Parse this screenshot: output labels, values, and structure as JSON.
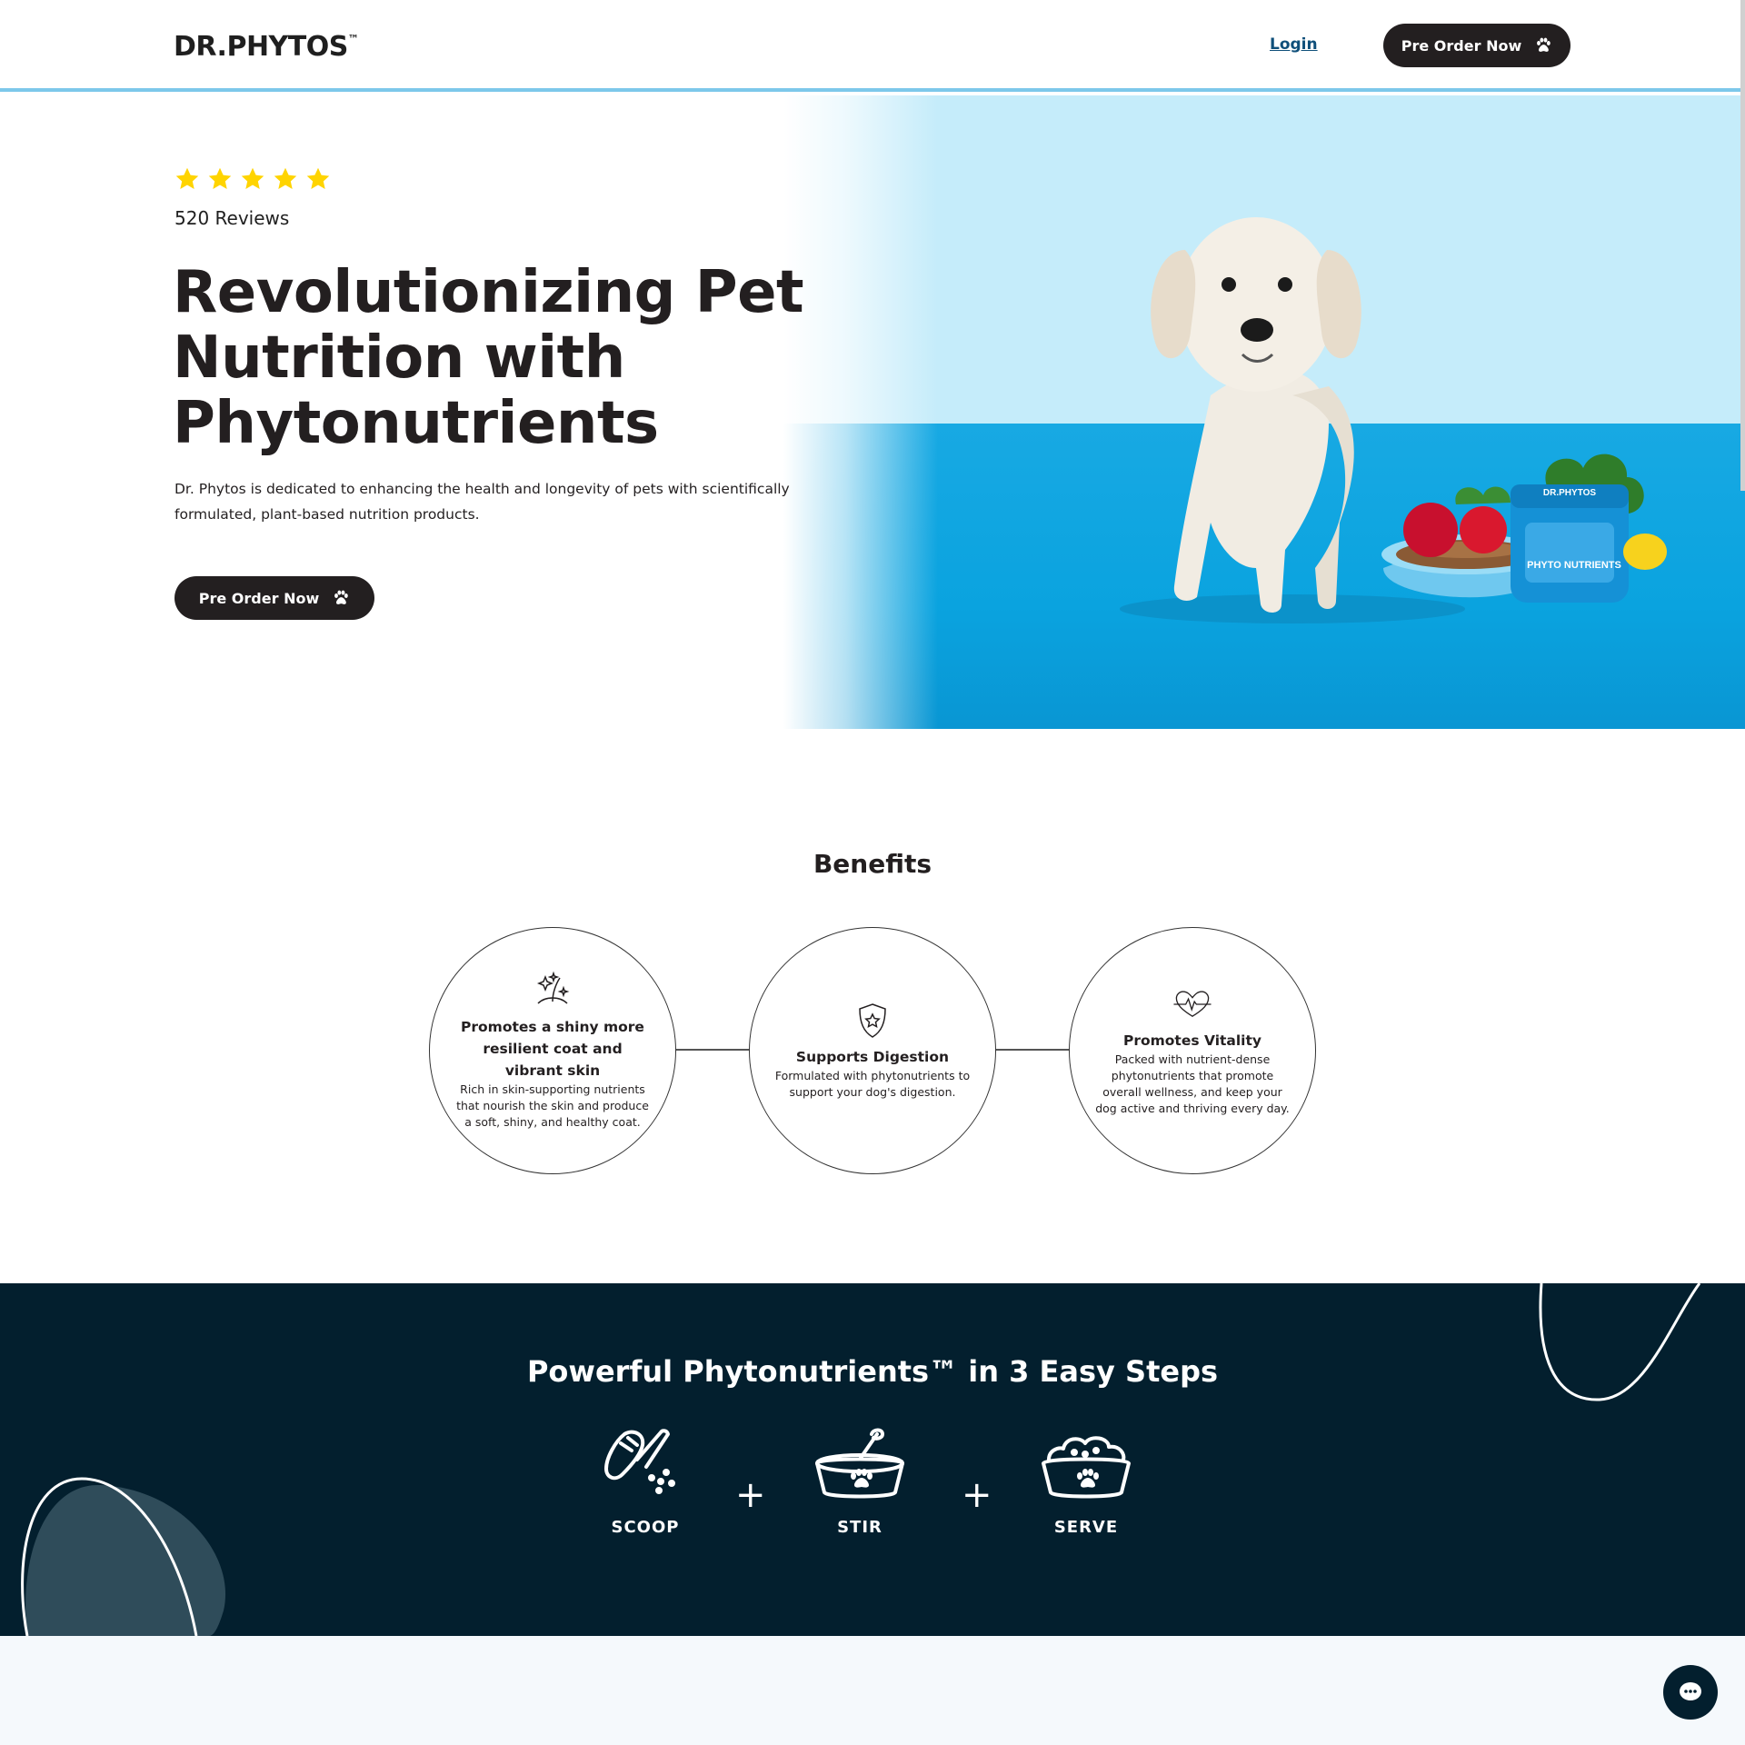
{
  "header": {
    "logo_text": "DR.PHYTOS",
    "logo_tm": "™",
    "login_label": "Login",
    "cta_label": "Pre Order Now",
    "cta_icon": "paw-icon"
  },
  "hero": {
    "rating": 5,
    "reviews_label": "520 Reviews",
    "title": "Revolutionizing Pet Nutrition with Phytonutrients",
    "description": "Dr. Phytos is dedicated to enhancing the health and longevity of pets with scientifically formulated, plant-based nutrition products.",
    "cta_label": "Pre Order Now",
    "jar_brand": "DR.PHYTOS",
    "jar_label": "PHYTO NUTRIENTS"
  },
  "benefits": {
    "title": "Benefits",
    "items": [
      {
        "icon": "hair-sparkle-icon",
        "title": "Promotes a shiny more resilient coat and vibrant skin",
        "description": "Rich in skin-supporting nutrients that nourish the skin and produce a soft, shiny, and healthy coat."
      },
      {
        "icon": "shield-star-icon",
        "title": "Supports Digestion",
        "description": "Formulated with phytonutrients to support your dog's digestion."
      },
      {
        "icon": "heart-pulse-icon",
        "title": "Promotes Vitality",
        "description": "Packed with nutrient-dense phytonutrients that promote overall wellness, and keep your dog active and thriving every day."
      }
    ]
  },
  "steps": {
    "title": "Powerful Phytonutrients™ in 3 Easy Steps",
    "items": [
      {
        "icon": "scoop-icon",
        "label": "SCOOP"
      },
      {
        "icon": "stir-bowl-icon",
        "label": "STIR"
      },
      {
        "icon": "serve-bowl-icon",
        "label": "SERVE"
      }
    ],
    "separator": "+"
  },
  "colors": {
    "dark": "#231f20",
    "navy": "#031f2e",
    "accent_blue": "#7dc8ea",
    "star": "#ffd400",
    "link": "#0f4f7a"
  }
}
